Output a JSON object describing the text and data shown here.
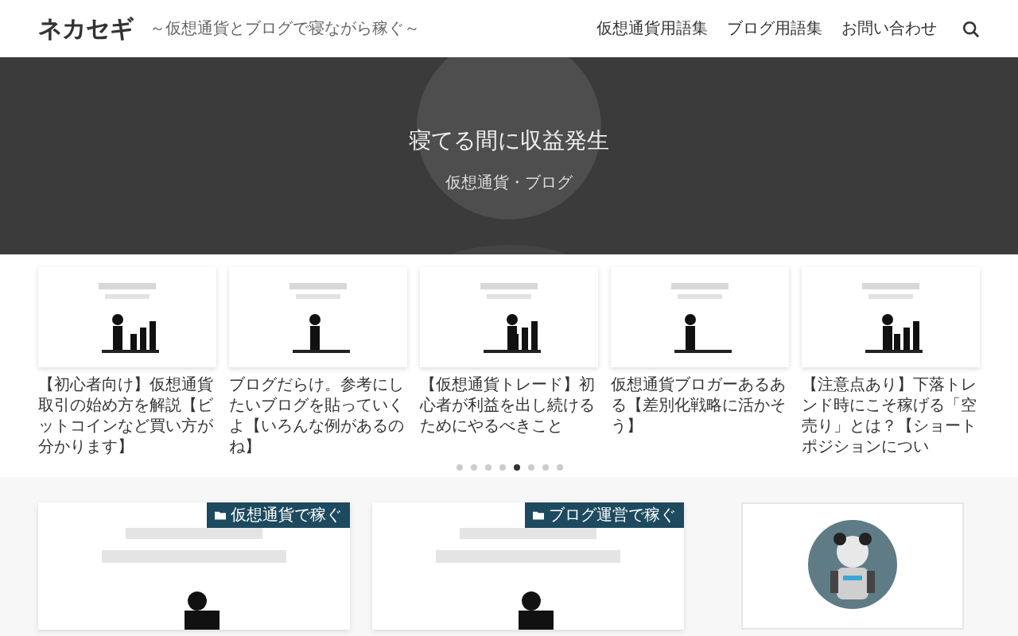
{
  "header": {
    "logo": "ネカセギ",
    "tagline": "～仮想通貨とブログで寝ながら稼ぐ～",
    "nav": [
      "仮想通貨用語集",
      "ブログ用語集",
      "お問い合わせ"
    ]
  },
  "hero": {
    "title": "寝てる間に収益発生",
    "subtitle": "仮想通貨・ブログ"
  },
  "carousel": {
    "posts": [
      {
        "title": "【初心者向け】仮想通貨取引の始め方を解説【ビットコインなど買い方が分かります】"
      },
      {
        "title": "ブログだらけ。参考にしたいブログを貼っていくよ【いろんな例があるのね】"
      },
      {
        "title": "【仮想通貨トレード】初心者が利益を出し続けるためにやるべきこと"
      },
      {
        "title": "仮想通貨ブロガーあるある【差別化戦略に活かそう】"
      },
      {
        "title": "【注意点あり】下落トレンド時にこそ稼げる「空売り」とは？【ショートポジションについ"
      }
    ],
    "dots": [
      {
        "selected": false
      },
      {
        "selected": false
      },
      {
        "selected": false
      },
      {
        "selected": false
      },
      {
        "selected": true
      },
      {
        "selected": false
      },
      {
        "selected": false
      },
      {
        "selected": false
      }
    ]
  },
  "cards": [
    {
      "category": "仮想通貨で稼ぐ"
    },
    {
      "category": "ブログ運営で稼ぐ"
    }
  ]
}
